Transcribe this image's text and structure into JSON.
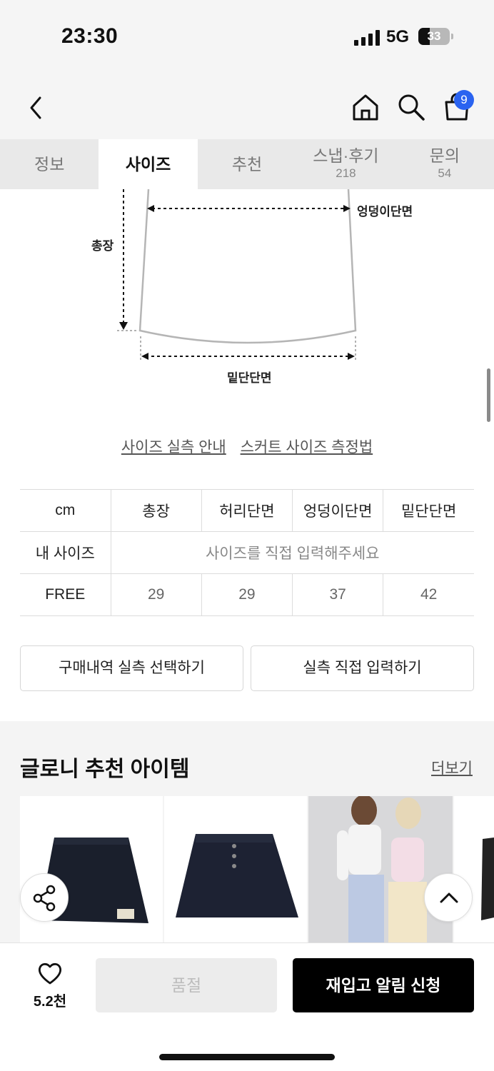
{
  "status": {
    "time": "23:30",
    "network": "5G",
    "battery": "33"
  },
  "header": {
    "cart_count": "9"
  },
  "tabs": [
    {
      "label": "정보",
      "count": ""
    },
    {
      "label": "사이즈",
      "count": ""
    },
    {
      "label": "추천",
      "count": ""
    },
    {
      "label": "스냅·후기",
      "count": "218"
    },
    {
      "label": "문의",
      "count": "54"
    }
  ],
  "diagram": {
    "hip": "엉덩이단면",
    "length": "총장",
    "hem": "밑단단면"
  },
  "size_links": {
    "actual_guide": "사이즈 실측 안내",
    "measure_method": "스커트 사이즈 측정법"
  },
  "size_table": {
    "header": [
      "cm",
      "총장",
      "허리단면",
      "엉덩이단면",
      "밑단단면"
    ],
    "my_size_label": "내 사이즈",
    "my_size_hint": "사이즈를 직접 입력해주세요",
    "rows": [
      {
        "size": "FREE",
        "values": [
          "29",
          "29",
          "37",
          "42"
        ]
      }
    ]
  },
  "actions": {
    "select_history": "구매내역 실측 선택하기",
    "direct_input": "실측 직접 입력하기"
  },
  "recommend": {
    "title": "글로니 추천 아이템",
    "more": "더보기"
  },
  "bottom": {
    "like_count": "5.2천",
    "soldout": "품절",
    "restock": "재입고 알림 신청"
  },
  "colors": {
    "accent": "#2a63f0",
    "primary_button": "#000000",
    "disabled_button": "#ececec"
  }
}
